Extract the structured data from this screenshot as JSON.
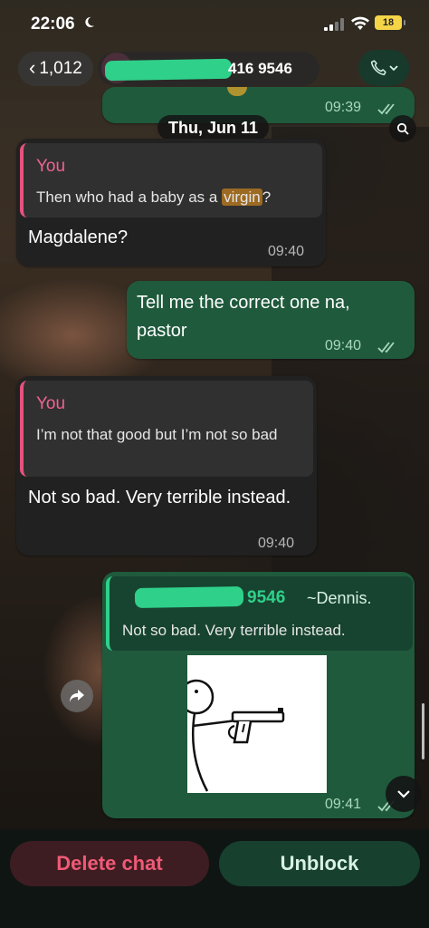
{
  "status_bar": {
    "time": "22:06",
    "battery": "18"
  },
  "header": {
    "back_count": "1,012",
    "contact_number": "416 9546"
  },
  "date_separator": "Thu, Jun 11",
  "messages": [
    {
      "direction": "out",
      "time": "09:39"
    },
    {
      "direction": "in",
      "quote_author": "You",
      "quote_text_before": "Then who had a baby as a ",
      "quote_highlight": "virgin",
      "quote_text_after": "?",
      "text": "Magdalene?",
      "time": "09:40"
    },
    {
      "direction": "out",
      "text": "Tell me the correct one na, pastor",
      "time": "09:40"
    },
    {
      "direction": "in",
      "quote_author": "You",
      "quote_text": "I’m not that good but I’m not so bad",
      "text": "Not so bad. Very terrible instead.",
      "time": "09:40"
    },
    {
      "direction": "out",
      "quote_author_number": "9546",
      "quote_author_name": "~Dennis.",
      "quote_text": "Not so bad. Very terrible instead.",
      "sticker": "stick-figure-with-gun",
      "time": "09:41"
    }
  ],
  "actions": {
    "delete_label": "Delete chat",
    "unblock_label": "Unblock"
  },
  "colors": {
    "accent_green": "#2fd08a",
    "quote_pink": "#f06292",
    "delete_red": "#ef5a76"
  }
}
